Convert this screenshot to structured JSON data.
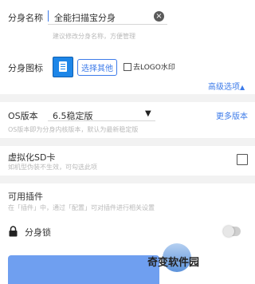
{
  "clone_name": {
    "label": "分身名称",
    "value": "全能扫描宝分身",
    "hint": "建议修改分身名称，方便管理"
  },
  "clone_icon": {
    "label": "分身图标",
    "choose_button": "选择其他",
    "remove_logo_label": "去LOGO水印",
    "remove_logo_checked": false
  },
  "advanced_options": "高级选项",
  "advanced_expanded": true,
  "os_version": {
    "label": "OS版本",
    "selected": "6.5稳定版",
    "more_link": "更多版本",
    "hint": "OS版本即为分身内核版本，默认为最新稳定版"
  },
  "virtual_sd": {
    "label": "虚拟化SD卡",
    "hint": "如机型伪装不生效，可勾选此项",
    "checked": false
  },
  "plugins": {
    "label": "可用插件",
    "hint": "在「插件」中，通过「配置」可对插件进行相关设置"
  },
  "clone_lock": {
    "label": "分身锁",
    "enabled": false
  },
  "watermark": {
    "text": "奇变软件园"
  },
  "colors": {
    "accent": "#3d7be9",
    "icon_blue": "#1d86e8",
    "bottom_button": "#6f9ff0"
  }
}
